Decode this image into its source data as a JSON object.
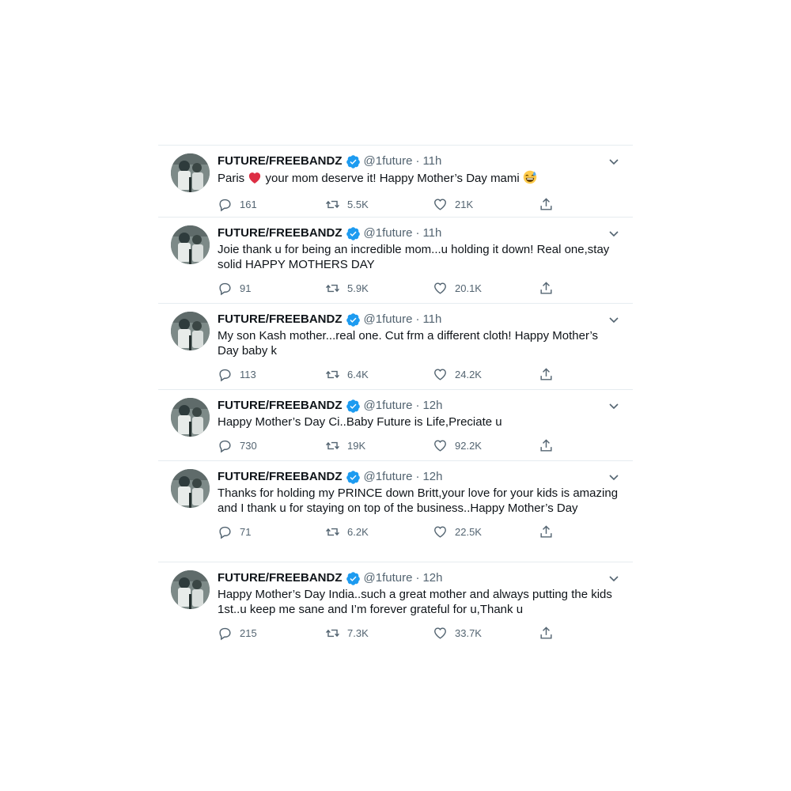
{
  "tweets": [
    {
      "name": "FUTURE/FREEBANDZ",
      "handle": "@1future",
      "time": "11h",
      "text_before": "Paris ",
      "emoji1": "heart",
      "text_mid": " your mom deserve it! Happy Mother’s Day mami ",
      "emoji2": "grinning-sweat",
      "replies": "161",
      "retweets": "5.5K",
      "likes": "21K"
    },
    {
      "name": "FUTURE/FREEBANDZ",
      "handle": "@1future",
      "time": "11h",
      "text": "Joie thank u for being an incredible mom...u holding it down! Real one,stay solid HAPPY MOTHERS DAY",
      "replies": "91",
      "retweets": "5.9K",
      "likes": "20.1K"
    },
    {
      "name": "FUTURE/FREEBANDZ",
      "handle": "@1future",
      "time": "11h",
      "text": "My son Kash mother...real one. Cut frm a different cloth! Happy Mother’s Day baby k",
      "replies": "113",
      "retweets": "6.4K",
      "likes": "24.2K"
    },
    {
      "name": "FUTURE/FREEBANDZ",
      "handle": "@1future",
      "time": "12h",
      "text": "Happy Mother’s Day Ci..Baby Future is Life,Preciate u",
      "replies": "730",
      "retweets": "19K",
      "likes": "92.2K"
    },
    {
      "name": "FUTURE/FREEBANDZ",
      "handle": "@1future",
      "time": "12h",
      "text": "Thanks for holding my PRINCE down Britt,your love for your kids is amazing and I thank u for staying on top of the business..Happy Mother’s Day",
      "replies": "71",
      "retweets": "6.2K",
      "likes": "22.5K"
    },
    {
      "name": "FUTURE/FREEBANDZ",
      "handle": "@1future",
      "time": "12h",
      "text": "Happy Mother’s Day India..such a great mother and always putting the kids 1st..u keep me sane and I’m forever grateful for u,Thank u",
      "replies": "215",
      "retweets": "7.3K",
      "likes": "33.7K"
    }
  ],
  "separator": "·",
  "colors": {
    "verified": "#1d9bf0",
    "muted": "#536471",
    "text": "#0f1419",
    "divider": "#e6ecf0"
  }
}
